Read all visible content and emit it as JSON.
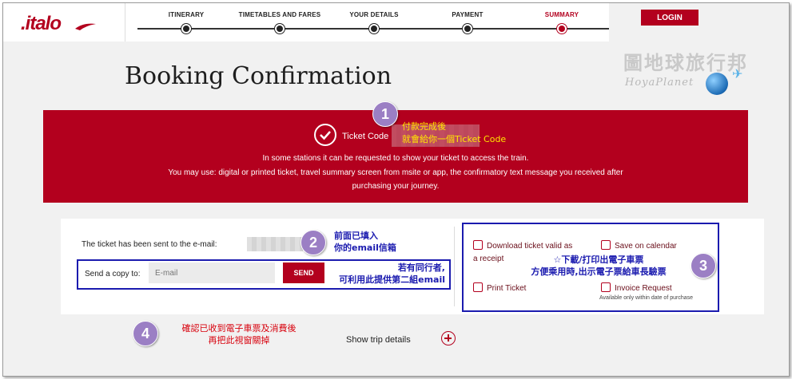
{
  "header": {
    "logo_text": ".italo",
    "steps": [
      {
        "label": "ITINERARY",
        "active": false
      },
      {
        "label": "TIMETABLES AND FARES",
        "active": false
      },
      {
        "label": "YOUR DETAILS",
        "active": false
      },
      {
        "label": "PAYMENT",
        "active": false
      },
      {
        "label": "SUMMARY",
        "active": true
      }
    ],
    "login_label": "LOGIN"
  },
  "watermark": {
    "title": "圖地球旅行邦",
    "subtitle": "HoyaPlanet"
  },
  "page_title": "Booking Confirmation",
  "banner": {
    "ticket_code_label": "Ticket Code",
    "line1": "In some stations it can be requested to show your ticket to access the train.",
    "line2": "You may use: digital or printed ticket, travel summary screen from msite or app, the confirmatory text message you received after",
    "line3": "purchasing your journey."
  },
  "email_panel": {
    "sent_text": "The ticket has been sent to the e-mail:",
    "copy_label": "Send a copy to:",
    "email_placeholder": "E-mail",
    "send_label": "SEND"
  },
  "actions": {
    "download_line1": "Download ticket valid as",
    "download_line2": "a receipt",
    "calendar": "Save on calendar",
    "print": "Print Ticket",
    "invoice": "Invoice Request",
    "invoice_note": "Available only within date of purchase"
  },
  "trip_details_label": "Show trip details",
  "annotations": {
    "n1": "1",
    "n2": "2",
    "n3": "3",
    "n4": "4",
    "a1_line1": "付款完成後",
    "a1_line2": "就會給你一個Ticket Code",
    "a2_line1": "前面已填入",
    "a2_line2": "你的email信箱",
    "a2_line3": "若有同行者,",
    "a2_line4": "可利用此提供第二組email",
    "a3_line1": "☆下載/打印出電子車票",
    "a3_line2": "方便乘用時,出示電子票給車長驗票",
    "a4_line1": "確認已收到電子車票及消費後",
    "a4_line2": "再把此視窗關掉"
  },
  "colors": {
    "brand_red": "#b3001e",
    "annotation_purple": "#9b7fc4",
    "annotation_blue": "#1b1baf",
    "annotation_yellow": "#ffe600"
  }
}
